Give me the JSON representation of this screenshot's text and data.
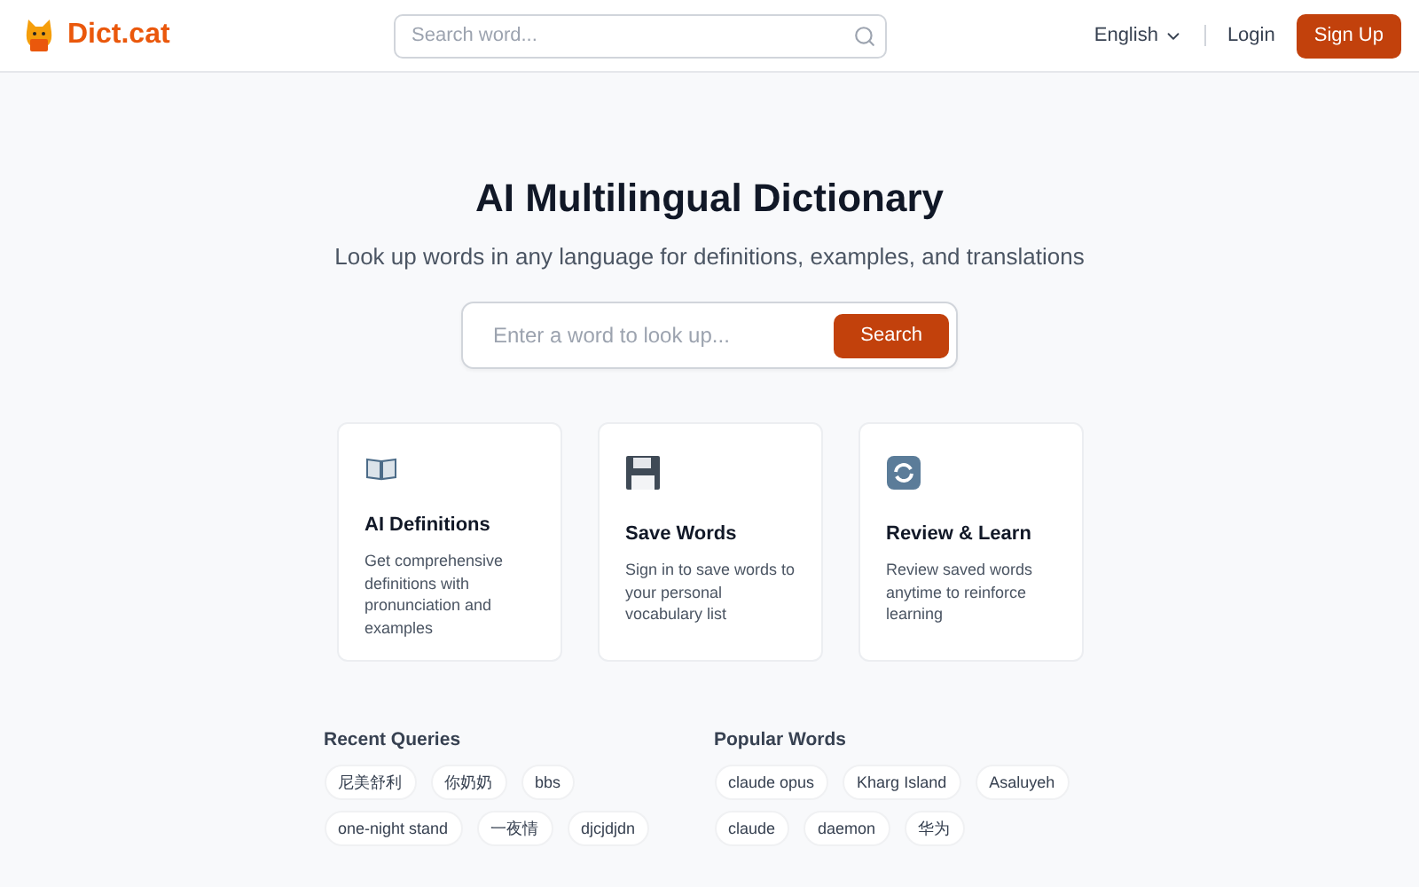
{
  "header": {
    "logo": "Dict.cat",
    "search": {
      "placeholder": "Search word..."
    },
    "language": "English",
    "login": "Login",
    "signup": "Sign Up"
  },
  "hero": {
    "title": "AI Multilingual Dictionary",
    "subtitle": "Look up words in any language for definitions, examples, and translations",
    "search": {
      "placeholder": "Enter a word to look up...",
      "button": "Search"
    }
  },
  "features": [
    {
      "kind": "book",
      "title": "AI Definitions",
      "text": "Get comprehensive definitions with pronunciation and examples"
    },
    {
      "kind": "save",
      "title": "Save Words",
      "text": "Sign in to save words to your personal vocabulary list"
    },
    {
      "kind": "review",
      "title": "Review & Learn",
      "text": "Review saved words anytime to reinforce learning"
    }
  ],
  "recent": {
    "title": "Recent Queries",
    "words": [
      "尼美舒利",
      "你奶奶",
      "bbs",
      "one-night stand",
      "一夜情",
      "djcjdjdn"
    ]
  },
  "popular": {
    "title": "Popular Words",
    "words": [
      "claude opus",
      "Kharg Island",
      "Asaluyeh",
      "claude",
      "daemon",
      "华为"
    ]
  }
}
